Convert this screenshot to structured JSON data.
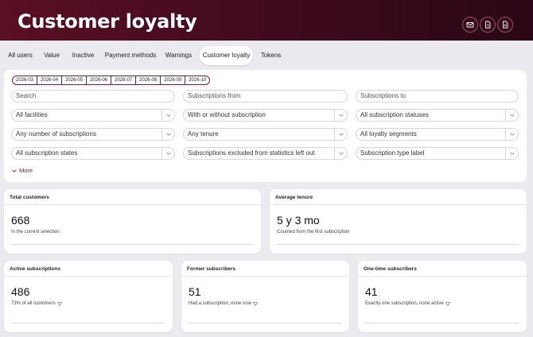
{
  "header": {
    "title": "Customer loyalty",
    "actions": [
      {
        "name": "email-button",
        "icon": "mail-icon"
      },
      {
        "name": "export-pdf-button",
        "icon": "pdf-icon"
      },
      {
        "name": "export-document-button",
        "icon": "document-icon"
      }
    ]
  },
  "tabs": [
    {
      "label": "All users"
    },
    {
      "label": "Value"
    },
    {
      "label": "Inactive"
    },
    {
      "label": "Payment methods"
    },
    {
      "label": "Warnings"
    },
    {
      "label": "Customer loyalty",
      "active": true
    },
    {
      "label": "Tokens"
    }
  ],
  "filters": {
    "months": [
      "2026-03",
      "2026-04",
      "2026-05",
      "2026-06",
      "2026-07",
      "2026-08",
      "2026-09",
      "2026-10"
    ],
    "search_placeholder": "Search",
    "subscriptions_from_placeholder": "Subscriptions from",
    "subscriptions_to_placeholder": "Subscriptions to",
    "facilities": "All facilities",
    "with_without_subscription": "With or without subscription",
    "subscription_statuses": "All subscription statuses",
    "number_of_subscriptions": "Any number of subscriptions",
    "tenure": "Any tenure",
    "loyalty_segments": "All loyalty segments",
    "subscription_states": "All subscription states",
    "excluded": "Subscriptions excluded from statistics left out",
    "type_label": "Subscription type label",
    "more_label": "More"
  },
  "cards": {
    "total_customers": {
      "title": "Total customers",
      "value": "668",
      "subtitle": "In the current selection"
    },
    "average_tenure": {
      "title": "Average tenure",
      "value": "5 y 3 mo",
      "subtitle": "Counted from the first subscription"
    },
    "active_subscriptions": {
      "title": "Active subscriptions",
      "value": "486",
      "subtitle": "73% of all customers"
    },
    "former_subscribers": {
      "title": "Former subscribers",
      "value": "51",
      "subtitle": "Had a subscription, none now"
    },
    "one_time_subscribers": {
      "title": "One-time subscribers",
      "value": "41",
      "subtitle": "Exactly one subscription, none active"
    }
  },
  "colors": {
    "brand": "#5a0f24",
    "accent": "#7a1a33",
    "background": "#ebebef"
  }
}
